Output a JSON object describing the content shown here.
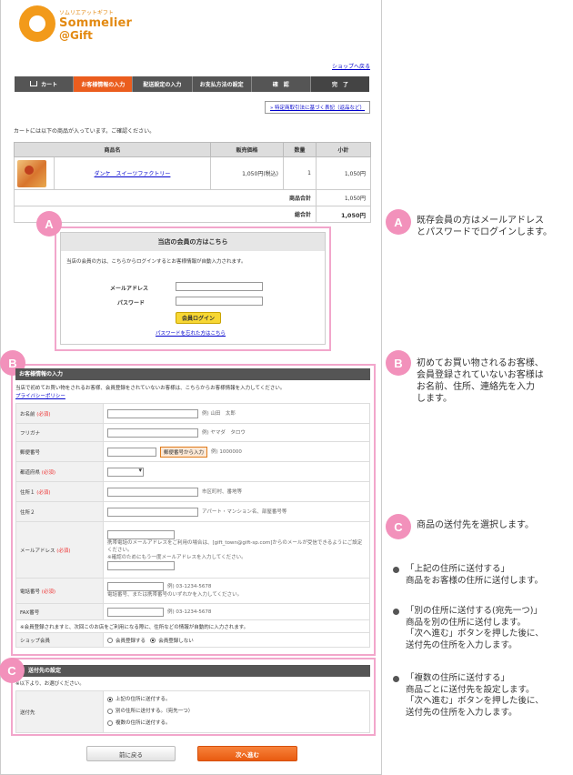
{
  "header": {
    "logo_sub": "ソムリエアットギフト",
    "logo_line1": "Sommelier",
    "logo_line2": "@Gift",
    "shop_back": "ショップへ戻る"
  },
  "steps": [
    "カート",
    "お客様情報の入力",
    "配送設定の入力",
    "お支払方法の設定",
    "確　認",
    "完　了"
  ],
  "legal_link": "» 特定商取引法に基づく表記（返品など）",
  "cart": {
    "intro": "カートには以下の商品が入っています。ご確認ください。",
    "headers": [
      "商品名",
      "販売価格",
      "数量",
      "小計"
    ],
    "product": {
      "name": "ダンケ　スイーツファクトリー",
      "price": "1,050円(税込)",
      "qty": "1",
      "subtotal": "1,050円"
    },
    "subtotal_label": "商品合計",
    "subtotal_value": "1,050円",
    "total_label": "総合計",
    "total_value": "1,050円"
  },
  "login": {
    "title": "当店の会員の方はこちら",
    "note": "当店の会員の方は、こちらからログインするとお客様情報が自動入力されます。",
    "mail_label": "メールアドレス",
    "pass_label": "パスワード",
    "button": "会員ログイン",
    "forgot": "パスワードを忘れた方はこちら"
  },
  "customer": {
    "title": "お客様情報の入力",
    "note": "当店で初めてお買い物をされるお客様、会員登録をされていないお客様は、こちらからお客様情報を入力してください。",
    "privacy": "プライバシーポリシー",
    "required": "(必須)",
    "rows": {
      "name": {
        "label": "お名前",
        "hint": "例) 山田　太郎"
      },
      "kana": {
        "label": "フリガナ",
        "hint": "例) ヤマダ　タロウ"
      },
      "zip": {
        "label": "郵便番号",
        "button": "郵便番号から入力",
        "hint": "例) 1000000"
      },
      "pref": {
        "label": "都道府県"
      },
      "addr1": {
        "label": "住所１",
        "hint": "市区町村、番地等"
      },
      "addr2": {
        "label": "住所２",
        "hint": "アパート・マンション名、部屋番号等"
      },
      "email": {
        "label": "メールアドレス",
        "note1": "携帯電話のメールアドレスをご利用の場合は、[gift_town@gift-sp.com]からのメールが受信できるようにご設定ください。",
        "note2": "※確認のためにもう一度メールアドレスを入力してください。"
      },
      "tel": {
        "label": "電話番号",
        "hint": "例) 03-1234-5678",
        "sub": "電話番号、または携帯番号のいずれかを入力してください。"
      },
      "fax": {
        "label": "FAX番号",
        "hint": "例) 03-1234-5678"
      }
    },
    "member_note": "※会員登録されますと、次回このお店をご利用になる際に、住所などの情報が自動的に入力されます。",
    "member_label": "ショップ会員",
    "member_opt1": "会員登録する",
    "member_opt2": "会員登録しない"
  },
  "shipping": {
    "title": "送付先の設定",
    "note": "※以下より、お選びください。",
    "label": "送付先",
    "opt1": "上記の住所に送付する。",
    "opt2": "別の住所に送付する。（宛先一つ）",
    "opt3": "複数の住所に送付する。"
  },
  "buttons": {
    "back": "前に戻る",
    "next": "次へ進む"
  },
  "annotations": {
    "A": {
      "letter": "A",
      "lines": [
        "既存会員の方はメールアドレス",
        "とパスワードでログインします。"
      ]
    },
    "B": {
      "letter": "B",
      "lines": [
        "初めてお買い物されるお客様、",
        "会員登録されていないお客様は",
        "お名前、住所、連絡先を入力",
        "します。"
      ]
    },
    "C": {
      "letter": "C",
      "lines": [
        "商品の送付先を選択します。"
      ]
    },
    "notes": [
      [
        "「上記の住所に送付する」",
        "商品をお客様の住所に送付します。"
      ],
      [
        "「別の住所に送付する(宛先一つ)」",
        "商品を別の住所に送付します。",
        "「次へ進む」ボタンを押した後に、",
        "送付先の住所を入力します。"
      ],
      [
        "「複数の住所に送付する」",
        "商品ごとに送付先を設定します。",
        "「次へ進む」ボタンを押した後に、",
        "送付先の住所を入力します。"
      ]
    ]
  }
}
